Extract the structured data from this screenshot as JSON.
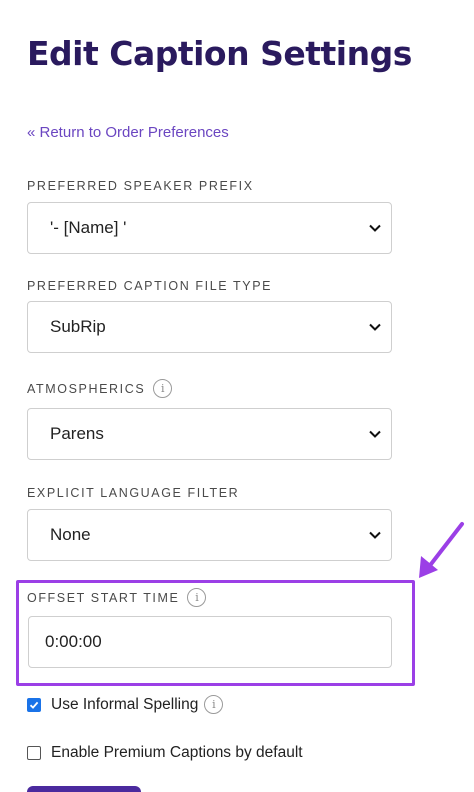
{
  "page": {
    "title": "Edit Caption Settings",
    "back_link": "« Return to Order Preferences"
  },
  "fields": {
    "speaker_prefix": {
      "label": "PREFERRED SPEAKER PREFIX",
      "value": "'- [Name] '"
    },
    "caption_file_type": {
      "label": "PREFERRED CAPTION FILE TYPE",
      "value": "SubRip"
    },
    "atmospherics": {
      "label": "ATMOSPHERICS",
      "value": "Parens",
      "icon": "info-icon"
    },
    "explicit_language": {
      "label": "EXPLICIT LANGUAGE FILTER",
      "value": "None"
    },
    "offset_start_time": {
      "label": "OFFSET START TIME",
      "value": "0:00:00",
      "icon": "info-icon"
    }
  },
  "options": {
    "informal_spelling": {
      "label": "Use Informal Spelling",
      "checked": true
    },
    "premium_captions": {
      "label": "Enable Premium Captions by default",
      "checked": false
    }
  },
  "info_glyph": "i",
  "colors": {
    "title": "#2a1a5e",
    "link": "#6b46c1",
    "highlight": "#9b3fe6",
    "checkbox_checked": "#1a73e8",
    "button": "#4b2a9e"
  }
}
